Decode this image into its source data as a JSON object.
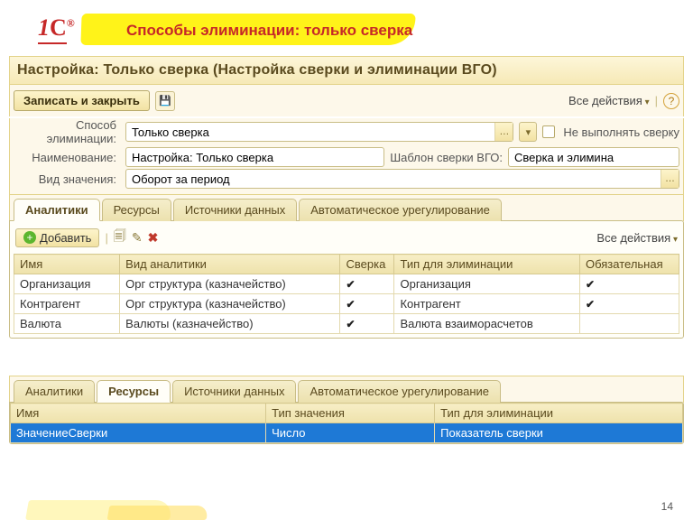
{
  "header": {
    "title": "Способы элиминации: только сверка"
  },
  "form": {
    "title": "Настройка: Только сверка (Настройка сверки и элиминации ВГО)",
    "save_close": "Записать и закрыть",
    "all_actions": "Все действия",
    "help_tip": "?",
    "fields": {
      "elim_method_lbl": "Способ элиминации:",
      "elim_method_val": "Только сверка",
      "no_reconcile": "Не выполнять сверку",
      "name_lbl": "Наименование:",
      "name_val": "Настройка: Только сверка",
      "template_lbl": "Шаблон сверки ВГО:",
      "template_val": "Сверка и элимина",
      "value_kind_lbl": "Вид значения:",
      "value_kind_val": "Оборот за период"
    },
    "tabs": {
      "t1": "Аналитики",
      "t2": "Ресурсы",
      "t3": "Источники данных",
      "t4": "Автоматическое урегулирование"
    },
    "grid1": {
      "add": "Добавить",
      "all_actions": "Все действия",
      "cols": {
        "c1": "Имя",
        "c2": "Вид аналитики",
        "c3": "Сверка",
        "c4": "Тип для элиминации",
        "c5": "Обязательная"
      },
      "rows": [
        {
          "c1": "Организация",
          "c2": "Орг структура (казначейство)",
          "c3": "✔",
          "c4": "Организация",
          "c5": "✔"
        },
        {
          "c1": "Контрагент",
          "c2": "Орг структура (казначейство)",
          "c3": "✔",
          "c4": "Контрагент",
          "c5": "✔"
        },
        {
          "c1": "Валюта",
          "c2": "Валюты (казначейство)",
          "c3": "✔",
          "c4": "Валюта взаиморасчетов",
          "c5": ""
        }
      ]
    },
    "grid2": {
      "cols": {
        "c1": "Имя",
        "c2": "Тип значения",
        "c3": "Тип для элиминации"
      },
      "row": {
        "c1": "ЗначениеСверки",
        "c2": "Число",
        "c3": "Показатель сверки"
      }
    }
  },
  "page_number": "14"
}
